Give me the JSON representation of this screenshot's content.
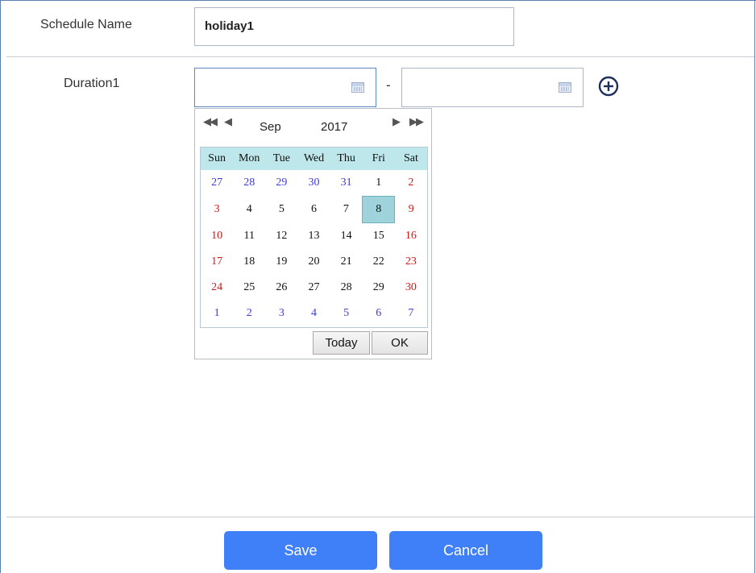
{
  "form": {
    "schedule_name_label": "Schedule Name",
    "schedule_name_value": "holiday1",
    "duration_label": "Duration1",
    "range_separator": "-",
    "start_date_value": "",
    "end_date_value": ""
  },
  "calendar": {
    "nav": {
      "prev_year": "◀◀",
      "prev_month": "◀",
      "next_month": "▶",
      "next_year": "▶▶"
    },
    "month": "Sep",
    "year": "2017",
    "weekdays": [
      "Sun",
      "Mon",
      "Tue",
      "Wed",
      "Thu",
      "Fri",
      "Sat"
    ],
    "weeks": [
      [
        "27",
        "28",
        "29",
        "30",
        "31",
        "1",
        "2"
      ],
      [
        "3",
        "4",
        "5",
        "6",
        "7",
        "8",
        "9"
      ],
      [
        "10",
        "11",
        "12",
        "13",
        "14",
        "15",
        "16"
      ],
      [
        "17",
        "18",
        "19",
        "20",
        "21",
        "22",
        "23"
      ],
      [
        "24",
        "25",
        "26",
        "27",
        "28",
        "29",
        "30"
      ],
      [
        "1",
        "2",
        "3",
        "4",
        "5",
        "6",
        "7"
      ]
    ],
    "selected_day": "8",
    "today_label": "Today",
    "ok_label": "OK"
  },
  "actions": {
    "save_label": "Save",
    "cancel_label": "Cancel"
  },
  "colors": {
    "accent": "#3f7ff8",
    "weekend": "#d41616",
    "other_month": "#3b3bdc",
    "header_bg": "#bde7ea",
    "selected_bg": "#9fd3db"
  },
  "icons": {
    "calendar": "calendar-icon",
    "add": "add-circle-icon"
  }
}
